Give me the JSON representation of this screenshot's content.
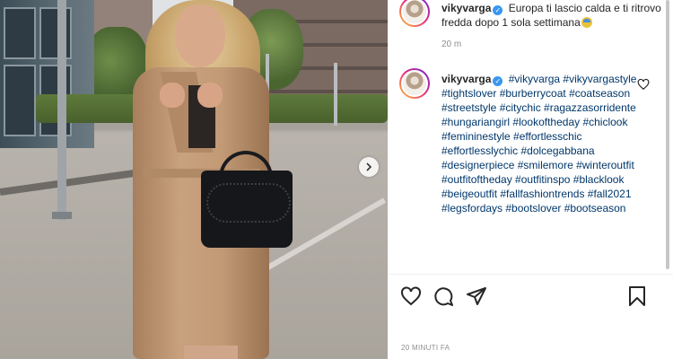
{
  "post": {
    "author": {
      "username": "vikyvarga",
      "verified": true
    },
    "caption_text": "Europa ti lascio calda e ti ritrovo fredda dopo 1 sola settimana",
    "caption_emoji": "cold-face-emoji",
    "caption_time": "20 m"
  },
  "comment": {
    "username": "vikyvarga",
    "verified": true,
    "tags": "#vikyvarga #vikyvargastyle #tightslover #burberrycoat #coatseason #streetstyle #citychic #ragazzasorridente #hungariangirl #lookoftheday #chiclook #femininestyle #effortlesschic #effortlesslychic #dolcegabbana #designerpiece #smilemore #winteroutfit #outfitoftheday #outfitinspo #blacklook #beigeoutfit #fallfashiontrends #fall2021 #legsfordays #bootslover #bootseason"
  },
  "footer": {
    "timestamp": "20 MINUTI FA"
  },
  "icons": {
    "like": "heart-icon",
    "comment": "comment-icon",
    "share": "send-icon",
    "save": "bookmark-icon",
    "comment_like": "heart-icon",
    "next": "chevron-right-icon"
  },
  "colors": {
    "hashtag": "#00376b",
    "verified": "#3897f0",
    "muted": "#8e8e8e"
  }
}
